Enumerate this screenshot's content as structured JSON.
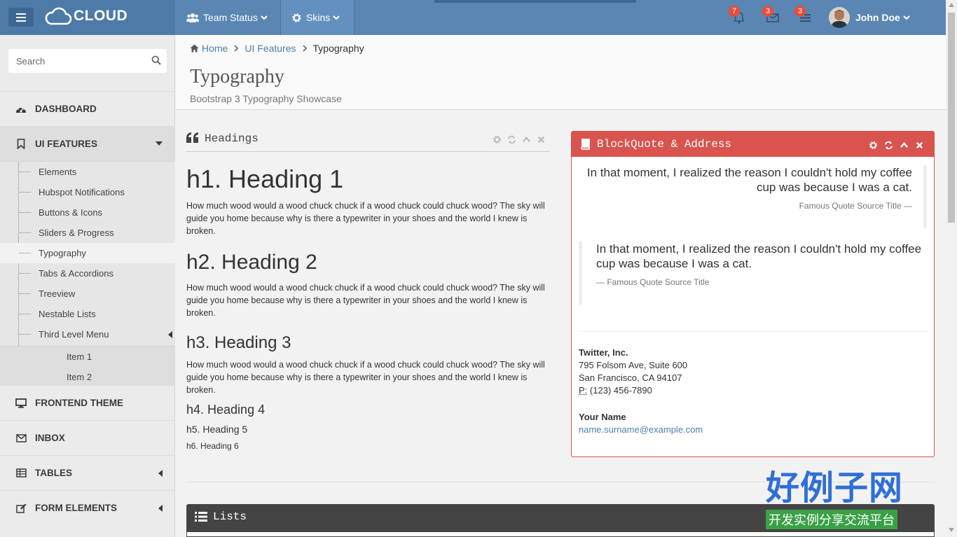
{
  "topbar": {
    "brand": "CLOUD",
    "nav": [
      {
        "label": "Team Status"
      },
      {
        "label": "Skins"
      }
    ],
    "notifications": [
      {
        "icon": "bell-icon",
        "count": "7",
        "badge_color": "#e74c3c"
      },
      {
        "icon": "envelope-icon",
        "count": "3",
        "badge_color": "#e74c3c"
      },
      {
        "icon": "tasks-icon",
        "count": "3",
        "badge_color": "#e74c3c"
      }
    ],
    "user": {
      "name": "John Doe"
    }
  },
  "sidebar": {
    "search": {
      "placeholder": "Search",
      "value": ""
    },
    "items": [
      {
        "label": "DASHBOARD",
        "icon": "dashboard-icon"
      },
      {
        "label": "UI FEATURES",
        "icon": "bookmark-icon"
      },
      {
        "label": "FRONTEND THEME",
        "icon": "desktop-icon"
      },
      {
        "label": "INBOX",
        "icon": "envelope-icon"
      },
      {
        "label": "TABLES",
        "icon": "table-icon"
      },
      {
        "label": "FORM ELEMENTS",
        "icon": "edit-icon"
      }
    ],
    "submenu": [
      {
        "label": "Elements"
      },
      {
        "label": "Hubspot Notifications"
      },
      {
        "label": "Buttons & Icons"
      },
      {
        "label": "Sliders & Progress"
      },
      {
        "label": "Typography"
      },
      {
        "label": "Tabs & Accordions"
      },
      {
        "label": "Treeview"
      },
      {
        "label": "Nestable Lists"
      },
      {
        "label": "Third Level Menu"
      }
    ],
    "third_level": [
      {
        "label": "Item 1"
      },
      {
        "label": "Item 2"
      }
    ]
  },
  "breadcrumb": {
    "home": "Home",
    "section": "UI Features",
    "current": "Typography"
  },
  "page": {
    "title": "Typography",
    "subtitle": "Bootstrap 3 Typography Showcase"
  },
  "headings_widget": {
    "title": "Headings",
    "h1": "h1. Heading 1",
    "h2": "h2. Heading 2",
    "h3": "h3. Heading 3",
    "h4": "h4. Heading 4",
    "h5": "h5. Heading 5",
    "h6": "h6. Heading 6",
    "p1": "How much wood would a wood chuck chuck if a wood chuck could chuck wood? The sky will guide you home because why is there a typewriter in your shoes and the world I knew is broken.",
    "p2": "How much wood would a wood chuck chuck if a wood chuck could chuck wood? The sky will guide you home because why is there a typewriter in your shoes and the world I knew is broken.",
    "p3": "How much wood would a wood chuck chuck if a wood chuck could chuck wood? The sky will guide you home because why is there a typewriter in your shoes and the world I knew is broken."
  },
  "quote_widget": {
    "title": "BlockQuote & Address",
    "header_color": "#d9534f",
    "quote1": {
      "text": "In that moment, I realized the reason I couldn't hold my coffee cup was because I was a cat.",
      "source": "Famous Quote Source Title —"
    },
    "quote2": {
      "text": "In that moment, I realized the reason I couldn't hold my coffee cup was because I was a cat.",
      "source": "— Famous Quote Source Title"
    },
    "address": {
      "company": "Twitter, Inc.",
      "line1": "795 Folsom Ave, Suite 600",
      "line2": "San Francisco, CA 94107",
      "phone_label": "P:",
      "phone": "(123) 456-7890",
      "name": "Your Name",
      "email": "name.surname@example.com"
    }
  },
  "lists_widget": {
    "title": "Lists"
  },
  "watermark": {
    "cn": "好例子网",
    "sub": "开发实例分享交流平台"
  }
}
